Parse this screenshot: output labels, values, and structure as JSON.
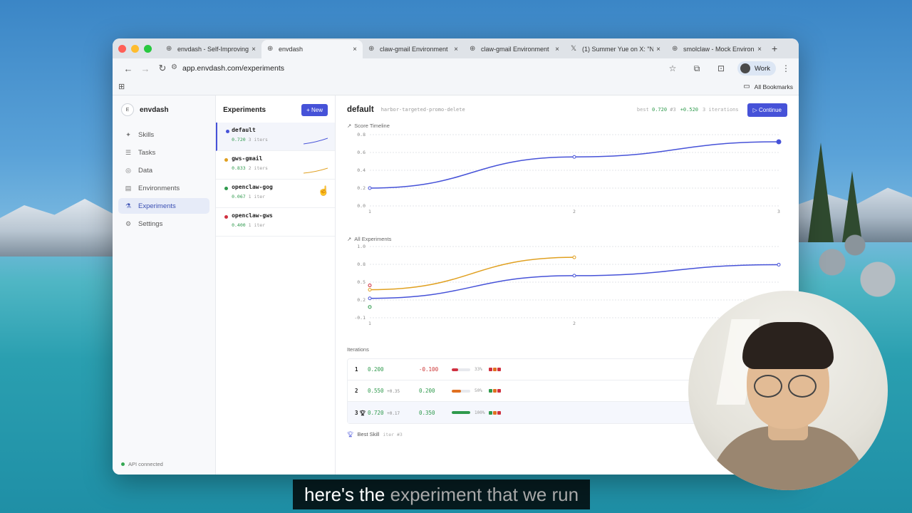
{
  "browser": {
    "tabs": [
      {
        "label": "envdash - Self-Improving",
        "favicon": "globe"
      },
      {
        "label": "envdash",
        "favicon": "globe",
        "active": true
      },
      {
        "label": "claw-gmail Environment",
        "favicon": "globe"
      },
      {
        "label": "claw-gmail Environment",
        "favicon": "globe"
      },
      {
        "label": "(1) Summer Yue on X: \"N",
        "favicon": "x-logo"
      },
      {
        "label": "smolclaw - Mock Environ",
        "favicon": "globe"
      }
    ],
    "url": "app.envdash.com/experiments",
    "profile": "Work",
    "bookmarks_label": "All Bookmarks"
  },
  "sidebar": {
    "brand_badge": "E",
    "brand": "envdash",
    "items": [
      {
        "label": "Skills",
        "icon": "sparkle-icon"
      },
      {
        "label": "Tasks",
        "icon": "list-icon"
      },
      {
        "label": "Data",
        "icon": "database-icon"
      },
      {
        "label": "Environments",
        "icon": "server-icon"
      },
      {
        "label": "Experiments",
        "icon": "flask-icon",
        "active": true
      },
      {
        "label": "Settings",
        "icon": "gear-icon"
      }
    ],
    "status": "API connected"
  },
  "experiments": {
    "title": "Experiments",
    "new_label": "+ New",
    "items": [
      {
        "name": "default",
        "score": "0.720",
        "iters": "3 iters",
        "color": "#4652d8",
        "active": true
      },
      {
        "name": "gws-gmail",
        "score": "0.833",
        "iters": "2 iters",
        "color": "#e0a020"
      },
      {
        "name": "openclaw-gog",
        "score": "0.067",
        "iters": "1 iter",
        "color": "#2f9a4d"
      },
      {
        "name": "openclaw-gws",
        "score": "0.400",
        "iters": "1 iter",
        "color": "#d03040"
      }
    ]
  },
  "main": {
    "title": "default",
    "subtitle": "harbor-targeted-promo-delete",
    "best_label": "best",
    "best_value": "0.720",
    "best_iter": "#3",
    "improvement": "+0.520",
    "iterations_count": "3 iterations",
    "continue_label": "▷ Continue",
    "score_timeline_label": "Score Timeline",
    "all_experiments_label": "All Experiments",
    "iterations_label": "Iterations",
    "best_skill_label": "Best Skill",
    "best_skill_iter": "iter #3",
    "iterations": [
      {
        "num": "1",
        "score": "0.200",
        "delta": "",
        "change": "-0.100",
        "pct": "33%",
        "progress": 0.33,
        "bar_color": "#d03040",
        "squares": [
          "#d03040",
          "#e07020",
          "#d03040"
        ]
      },
      {
        "num": "2",
        "score": "0.550",
        "delta": "+0.35",
        "change": "0.200",
        "pct": "50%",
        "progress": 0.5,
        "bar_color": "#e07020",
        "squares": [
          "#2f9a4d",
          "#e07020",
          "#d03040"
        ]
      },
      {
        "num": "3",
        "score": "0.720",
        "delta": "+0.17",
        "change": "0.350",
        "pct": "100%",
        "progress": 1.0,
        "bar_color": "#2f9a4d",
        "squares": [
          "#2f9a4d",
          "#e07020",
          "#d03040"
        ],
        "best": true
      }
    ]
  },
  "chart_data": [
    {
      "type": "line",
      "title": "Score Timeline",
      "x": [
        1,
        2,
        3
      ],
      "series": [
        {
          "values": [
            0.2,
            0.55,
            0.72
          ],
          "color": "#4652d8"
        }
      ],
      "yticks": [
        "0.8",
        "0.6",
        "0.4",
        "0.2",
        "0.0"
      ],
      "xticks": [
        "1",
        "2",
        "3"
      ],
      "ylim": [
        0,
        0.8
      ]
    },
    {
      "type": "line",
      "title": "All Experiments",
      "x": [
        1,
        2,
        3
      ],
      "series": [
        {
          "values": [
            0.2,
            0.55,
            0.72
          ],
          "color": "#4652d8"
        },
        {
          "values": [
            0.333,
            0.833
          ],
          "color": "#e0a020"
        },
        {
          "values": [
            0.067
          ],
          "color": "#2f9a4d"
        },
        {
          "values": [
            0.4
          ],
          "color": "#d03040"
        }
      ],
      "yticks": [
        "1.0",
        "0.8",
        "0.5",
        "0.2",
        "-0.1"
      ],
      "xticks": [
        "1",
        "2"
      ],
      "ylim": [
        -0.1,
        1.0
      ]
    }
  ],
  "subtitle": {
    "spoken": "here's the",
    "upcoming": "experiment that we run"
  }
}
